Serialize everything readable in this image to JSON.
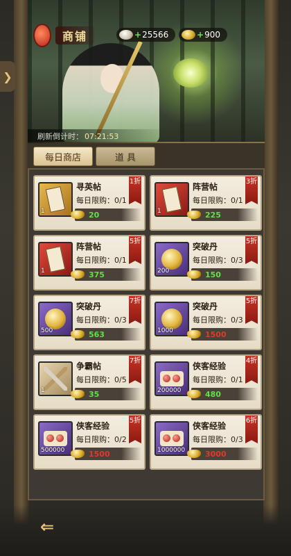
{
  "header": {
    "shop_title": "商铺",
    "currency_silver": "25566",
    "currency_gold": "900",
    "currency_plus": "+",
    "refresh_label": "刷新倒计时：",
    "refresh_timer": "07:21:53"
  },
  "tabs": [
    {
      "label": "每日商店",
      "active": true
    },
    {
      "label": "道 具",
      "active": false
    }
  ],
  "items": [
    {
      "name": "寻英帖",
      "limit": "每日限购：0/1",
      "qty": "1",
      "price": "20",
      "affordable": true,
      "discount": "1折",
      "icon": "recruit-ticket-icon",
      "bg": "gold"
    },
    {
      "name": "阵营帖",
      "limit": "每日限购：0/1",
      "qty": "1",
      "price": "225",
      "affordable": true,
      "discount": "3折",
      "icon": "faction-ticket-icon",
      "bg": "red"
    },
    {
      "name": "阵营帖",
      "limit": "每日限购：0/1",
      "qty": "1",
      "price": "375",
      "affordable": true,
      "discount": "5折",
      "icon": "faction-ticket-icon",
      "bg": "red"
    },
    {
      "name": "突破丹",
      "limit": "每日限购：0/3",
      "qty": "200",
      "price": "150",
      "affordable": true,
      "discount": "5折",
      "icon": "breakthrough-pill-icon",
      "bg": "purple"
    },
    {
      "name": "突破丹",
      "limit": "每日限购：0/3",
      "qty": "500",
      "price": "563",
      "affordable": true,
      "discount": "7折",
      "icon": "breakthrough-pill-icon",
      "bg": "purple"
    },
    {
      "name": "突破丹",
      "limit": "每日限购：0/3",
      "qty": "1000",
      "price": "1500",
      "affordable": false,
      "discount": "5折",
      "icon": "breakthrough-pill-icon",
      "bg": "purple"
    },
    {
      "name": "争霸帖",
      "limit": "每日限购：0/5",
      "qty": "1",
      "price": "35",
      "affordable": true,
      "discount": "7折",
      "icon": "contest-ticket-icon",
      "bg": "beige"
    },
    {
      "name": "侠客经验",
      "limit": "每日限购：0/1",
      "qty": "200000",
      "price": "480",
      "affordable": true,
      "discount": "4折",
      "icon": "hero-exp-icon",
      "bg": "purple"
    },
    {
      "name": "侠客经验",
      "limit": "每日限购：0/2",
      "qty": "500000",
      "price": "1500",
      "affordable": false,
      "discount": "5折",
      "icon": "hero-exp-icon",
      "bg": "purple"
    },
    {
      "name": "侠客经验",
      "limit": "每日限购：0/3",
      "qty": "1000000",
      "price": "3000",
      "affordable": false,
      "discount": "6折",
      "icon": "hero-exp-icon",
      "bg": "purple"
    }
  ],
  "colors": {
    "price_ok": "#62e04a",
    "price_bad": "#e03a2a",
    "discount_ribbon": "#c83424",
    "tab_active": "#f4e8c8"
  }
}
